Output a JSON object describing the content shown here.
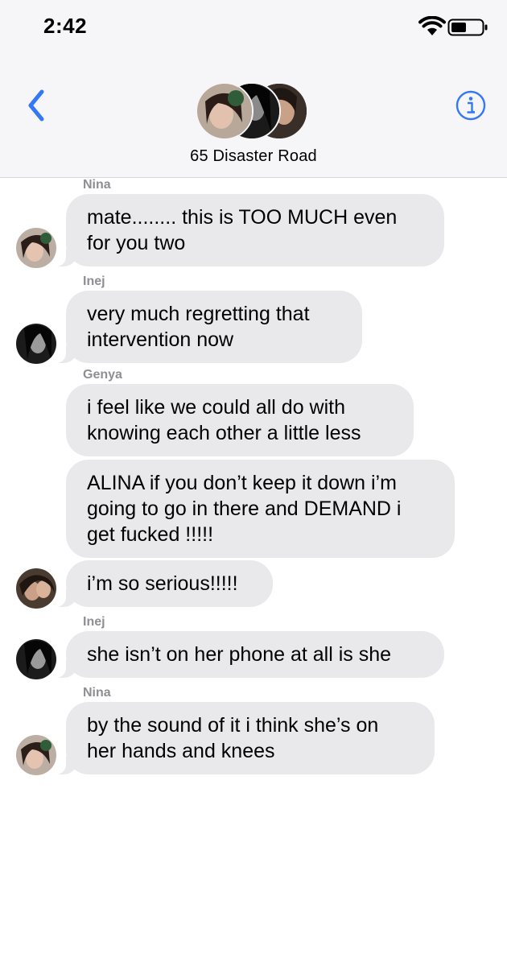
{
  "status_bar": {
    "time": "2:42",
    "wifi_icon": "wifi-icon",
    "battery_icon": "battery-icon"
  },
  "header": {
    "back_icon": "chevron-left-icon",
    "info_icon": "info-icon",
    "group_name": "65 Disaster Road",
    "accent_color": "#3478f6"
  },
  "messages": [
    {
      "sender": "Nina",
      "lines": [
        "mate........ this is TOO MUCH even",
        "for you two"
      ]
    },
    {
      "sender": "Inej",
      "lines": [
        "very much regretting that",
        "intervention now"
      ]
    },
    {
      "sender": "Genya",
      "lines": [
        "i feel like we could all do with",
        "knowing each other a little less"
      ]
    },
    {
      "sender": "",
      "lines": [
        "ALINA if you don’t keep it down i’m",
        "going to go in there and DEMAND i",
        "get fucked !!!!!"
      ]
    },
    {
      "sender": "",
      "lines": [
        "i’m so serious!!!!!"
      ]
    },
    {
      "sender": "Inej",
      "lines": [
        "she isn’t on her phone at all is she"
      ]
    },
    {
      "sender": "Nina",
      "lines": [
        "by the sound of it i think she’s on",
        "her hands and knees"
      ]
    }
  ],
  "colors": {
    "bubble": "#e9e9eb",
    "sender_label": "#8e8e93",
    "header_bg": "#f6f6f8"
  }
}
